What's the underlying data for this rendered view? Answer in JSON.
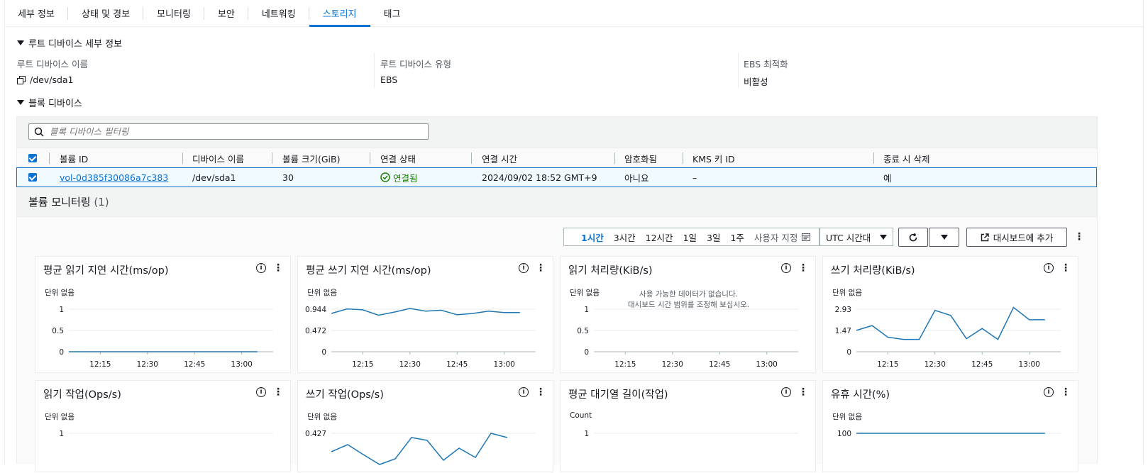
{
  "tabs": [
    {
      "label": "세부 정보",
      "active": false
    },
    {
      "label": "상태 및 경보",
      "active": false
    },
    {
      "label": "모니터링",
      "active": false
    },
    {
      "label": "보안",
      "active": false
    },
    {
      "label": "네트워킹",
      "active": false
    },
    {
      "label": "스토리지",
      "active": true
    },
    {
      "label": "태그",
      "active": false
    }
  ],
  "root_device": {
    "section_title": "루트 디바이스 세부 정보",
    "name_label": "루트 디바이스 이름",
    "name_value": "/dev/sda1",
    "type_label": "루트 디바이스 유형",
    "type_value": "EBS",
    "ebs_label": "EBS 최적화",
    "ebs_value": "비활성"
  },
  "block_devices": {
    "section_title": "블록 디바이스",
    "filter_placeholder": "블록 디바이스 필터링",
    "columns": [
      "볼륨 ID",
      "디바이스 이름",
      "볼륨 크기(GiB)",
      "연결 상태",
      "연결 시간",
      "암호화됨",
      "KMS 키 ID",
      "종료 시 삭제"
    ],
    "row": {
      "volume_id": "vol-0d385f30086a7c383",
      "device_name": "/dev/sda1",
      "size": "30",
      "status": "연결됨",
      "attach_time": "2024/09/02 18:52 GMT+9",
      "encrypted": "아니요",
      "kms_key": "–",
      "delete_on_termination": "예"
    }
  },
  "monitoring": {
    "title": "볼륨 모니터링",
    "count": "(1)",
    "ranges": [
      "1시간",
      "3시간",
      "12시간",
      "1일",
      "3일",
      "1주"
    ],
    "selected_range": "1시간",
    "custom_label": "사용자 지정",
    "timezone": "UTC 시간대",
    "add_dashboard": "대시보드에 추가",
    "colors": {
      "line": "#1f77b4",
      "accent": "#0972d3",
      "ok": "#1d8102"
    },
    "x_ticks": [
      "12:15",
      "12:30",
      "12:45",
      "13:00"
    ],
    "no_data_1": "사용 가능한 데이터가 없습니다.",
    "no_data_2": "대시보드 시간 범위를 조정해 보십시오.",
    "charts": [
      {
        "title": "평균 읽기 지연 시간(ms/op)",
        "unit": "단위 없음",
        "yticks": [
          "1",
          "0.5",
          "0"
        ]
      },
      {
        "title": "평균 쓰기 지연 시간(ms/op)",
        "unit": "단위 없음",
        "yticks": [
          "0.944",
          "0.472",
          "0"
        ]
      },
      {
        "title": "읽기 처리량(KiB/s)",
        "unit": "단위 없음",
        "yticks": [
          "1",
          "0.5",
          "0"
        ]
      },
      {
        "title": "쓰기 처리량(KiB/s)",
        "unit": "단위 없음",
        "yticks": [
          "2.93",
          "1.47",
          "0"
        ]
      },
      {
        "title": "읽기 작업(Ops/s)",
        "unit": "단위 없음",
        "yticks": [
          "1"
        ]
      },
      {
        "title": "쓰기 작업(Ops/s)",
        "unit": "단위 없음",
        "yticks": [
          "0.427"
        ]
      },
      {
        "title": "평균 대기열 길이(작업)",
        "unit": "Count",
        "yticks": [
          "1"
        ]
      },
      {
        "title": "유휴 시간(%)",
        "unit": "단위 없음",
        "yticks": [
          "100"
        ]
      }
    ]
  },
  "chart_data": [
    {
      "type": "line",
      "title": "평균 읽기 지연 시간(ms/op)",
      "ylabel": "단위 없음",
      "ylim": [
        0,
        1
      ],
      "x": [
        "12:05",
        "12:10",
        "12:15",
        "12:20",
        "12:25",
        "12:30",
        "12:35",
        "12:40",
        "12:45",
        "12:50",
        "12:55",
        "13:00",
        "13:05"
      ],
      "series": [
        {
          "values": [
            0,
            0,
            0,
            0,
            0,
            0,
            0,
            0,
            0,
            0,
            0,
            0,
            0
          ]
        }
      ]
    },
    {
      "type": "line",
      "title": "평균 쓰기 지연 시간(ms/op)",
      "ylabel": "단위 없음",
      "ylim": [
        0,
        0.944
      ],
      "x": [
        "12:05",
        "12:10",
        "12:15",
        "12:20",
        "12:25",
        "12:30",
        "12:35",
        "12:40",
        "12:45",
        "12:50",
        "12:55",
        "13:00",
        "13:05"
      ],
      "series": [
        {
          "values": [
            0.85,
            0.95,
            0.93,
            0.81,
            0.88,
            0.96,
            0.9,
            0.92,
            0.82,
            0.85,
            0.9,
            0.87,
            0.87
          ]
        }
      ]
    },
    {
      "type": "line",
      "title": "읽기 처리량(KiB/s)",
      "ylabel": "단위 없음",
      "ylim": [
        0,
        1
      ],
      "x": [],
      "series": []
    },
    {
      "type": "line",
      "title": "쓰기 처리량(KiB/s)",
      "ylabel": "단위 없음",
      "ylim": [
        0,
        2.93
      ],
      "x": [
        "12:05",
        "12:10",
        "12:15",
        "12:20",
        "12:25",
        "12:30",
        "12:35",
        "12:40",
        "12:45",
        "12:50",
        "12:55",
        "13:00",
        "13:05"
      ],
      "series": [
        {
          "values": [
            1.47,
            1.8,
            1.0,
            0.85,
            0.85,
            2.85,
            2.5,
            0.9,
            1.6,
            0.85,
            3.05,
            2.2,
            2.2
          ]
        }
      ]
    },
    {
      "type": "line",
      "title": "유휴 시간(%)",
      "ylabel": "단위 없음",
      "ylim": [
        0,
        100
      ],
      "x": [
        "12:05",
        "13:05"
      ],
      "series": [
        {
          "values": [
            100,
            100
          ]
        }
      ]
    }
  ]
}
